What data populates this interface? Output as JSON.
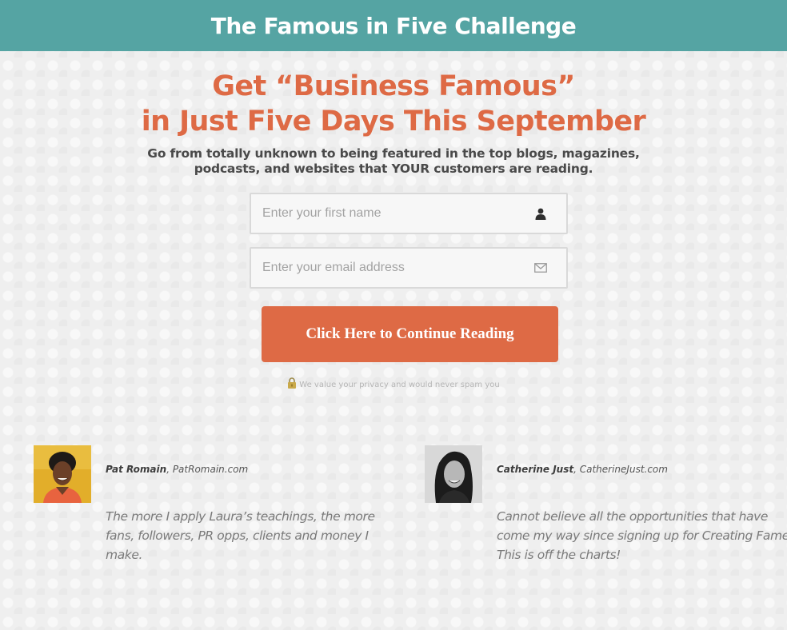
{
  "header": {
    "title": "The Famous in Five Challenge"
  },
  "hero": {
    "headline_line1": "Get “Business Famous”",
    "headline_line2": "in Just Five Days This September",
    "subhead_line1": "Go from totally unknown to being featured in the top blogs, magazines,",
    "subhead_line2": "podcasts, and websites that YOUR customers are reading."
  },
  "form": {
    "first_name_placeholder": "Enter your first name",
    "first_name_value": "",
    "first_name_icon": "user-icon",
    "email_placeholder": "Enter your email address",
    "email_value": "",
    "email_icon": "envelope-icon",
    "submit_label": "Click Here to Continue Reading",
    "privacy_icon": "lock-icon",
    "privacy_text": "We value your privacy and would never spam you"
  },
  "testimonials": [
    {
      "name": "Pat Romain",
      "site": ", PatRomain.com",
      "quote_lines": [
        "The more I apply Laura’s teachings, the more",
        "fans, followers, PR opps, clients and money I",
        "make."
      ]
    },
    {
      "name": "Catherine Just",
      "site": ", CatherineJust.com",
      "quote_lines": [
        "Cannot believe all the opportunities that have",
        "come my way since signing up for Creating Fame.",
        "This is off the charts!"
      ]
    }
  ],
  "colors": {
    "header_bg": "#55a4a3",
    "accent": "#de6a45",
    "page_bg": "#efefef"
  }
}
